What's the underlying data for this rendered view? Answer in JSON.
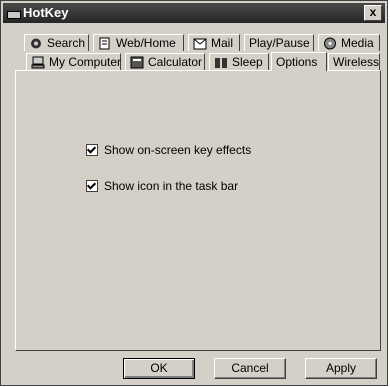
{
  "window": {
    "title": "HotKey",
    "close_label": "x"
  },
  "tabs": {
    "row_back": [
      {
        "label": "Search",
        "icon": "search-gear-icon"
      },
      {
        "label": "Web/Home",
        "icon": "web-home-icon"
      },
      {
        "label": "Mail",
        "icon": "mail-icon"
      },
      {
        "label": "Play/Pause",
        "icon": ""
      },
      {
        "label": "Media",
        "icon": "media-icon"
      }
    ],
    "row_front": [
      {
        "label": "My Computer",
        "icon": "computer-icon"
      },
      {
        "label": "Calculator",
        "icon": "calculator-icon"
      },
      {
        "label": "Sleep",
        "icon": "sleep-icon"
      },
      {
        "label": "Options",
        "icon": ""
      },
      {
        "label": "Wireless",
        "icon": ""
      }
    ],
    "active": "Options"
  },
  "options": {
    "show_key_effects": {
      "label": "Show on-screen key effects",
      "checked": true
    },
    "show_tray_icon": {
      "label": "Show icon in the task bar",
      "checked": true
    }
  },
  "buttons": {
    "ok": "OK",
    "cancel": "Cancel",
    "apply": "Apply"
  }
}
